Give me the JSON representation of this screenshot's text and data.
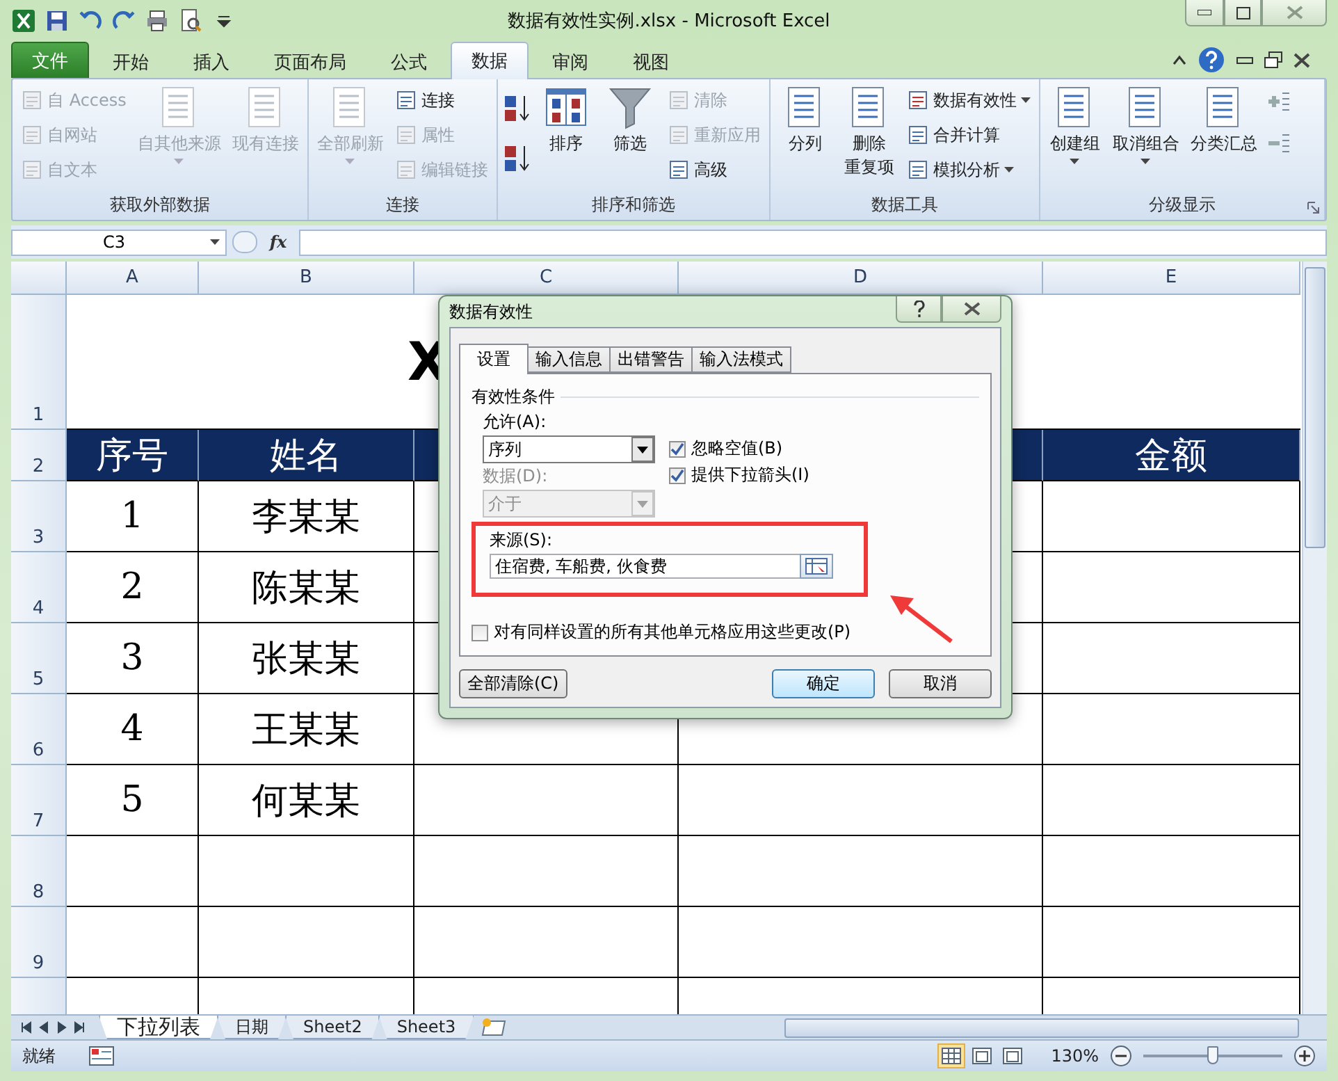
{
  "window": {
    "title": "数据有效性实例.xlsx - Microsoft Excel"
  },
  "ribbon_tabs": [
    {
      "label": "文件",
      "kind": "file",
      "selected": false
    },
    {
      "label": "开始",
      "kind": "tab",
      "selected": false
    },
    {
      "label": "插入",
      "kind": "tab",
      "selected": false
    },
    {
      "label": "页面布局",
      "kind": "tab",
      "selected": false
    },
    {
      "label": "公式",
      "kind": "tab",
      "selected": false
    },
    {
      "label": "数据",
      "kind": "tab",
      "selected": true
    },
    {
      "label": "审阅",
      "kind": "tab",
      "selected": false
    },
    {
      "label": "视图",
      "kind": "tab",
      "selected": false
    }
  ],
  "ribbon_groups": [
    {
      "label": "获取外部数据",
      "launcher": false,
      "items": [
        {
          "kind": "stack",
          "entries": [
            {
              "label": "自 Access",
              "disabled": true,
              "dropdown": false
            },
            {
              "label": "自网站",
              "disabled": true,
              "dropdown": false
            },
            {
              "label": "自文本",
              "disabled": true,
              "dropdown": false
            }
          ]
        },
        {
          "kind": "large",
          "label": "自其他来源",
          "disabled": true,
          "dropdown": true
        },
        {
          "kind": "large",
          "label": "现有连接",
          "disabled": true,
          "dropdown": false
        }
      ]
    },
    {
      "label": "连接",
      "launcher": false,
      "items": [
        {
          "kind": "large",
          "label": "全部刷新",
          "disabled": true,
          "dropdown": true
        },
        {
          "kind": "stack",
          "entries": [
            {
              "label": "连接",
              "disabled": false,
              "dropdown": false
            },
            {
              "label": "属性",
              "disabled": true,
              "dropdown": false
            },
            {
              "label": "编辑链接",
              "disabled": true,
              "dropdown": false
            }
          ]
        }
      ]
    },
    {
      "label": "排序和筛选",
      "launcher": false,
      "items": [
        {
          "kind": "sort"
        },
        {
          "kind": "large",
          "label": "排序",
          "disabled": false,
          "dropdown": false
        },
        {
          "kind": "large",
          "label": "筛选",
          "disabled": false,
          "dropdown": false
        },
        {
          "kind": "stack",
          "entries": [
            {
              "label": "清除",
              "disabled": true,
              "dropdown": false
            },
            {
              "label": "重新应用",
              "disabled": true,
              "dropdown": false
            },
            {
              "label": "高级",
              "disabled": false,
              "dropdown": false
            }
          ]
        }
      ]
    },
    {
      "label": "数据工具",
      "launcher": false,
      "items": [
        {
          "kind": "large",
          "label": "分列",
          "disabled": false,
          "dropdown": false
        },
        {
          "kind": "large",
          "lines": [
            "删除",
            "重复项"
          ],
          "disabled": false,
          "dropdown": false
        },
        {
          "kind": "stack",
          "entries": [
            {
              "label": "数据有效性",
              "disabled": false,
              "dropdown": true
            },
            {
              "label": "合并计算",
              "disabled": false,
              "dropdown": false
            },
            {
              "label": "模拟分析",
              "disabled": false,
              "dropdown": true
            }
          ]
        }
      ]
    },
    {
      "label": "分级显示",
      "launcher": true,
      "items": [
        {
          "kind": "large",
          "label": "创建组",
          "disabled": false,
          "dropdown": true
        },
        {
          "kind": "large",
          "label": "取消组合",
          "disabled": false,
          "dropdown": true
        },
        {
          "kind": "large",
          "label": "分类汇总",
          "disabled": false,
          "dropdown": false
        },
        {
          "kind": "detail"
        }
      ]
    }
  ],
  "formula_bar": {
    "name_box": "C3",
    "fx": "fx"
  },
  "sheet": {
    "columns": [
      "A",
      "B",
      "C",
      "D",
      "E"
    ],
    "row_numbers": [
      "1",
      "2",
      "3",
      "4",
      "5",
      "6",
      "7",
      "8",
      "9"
    ],
    "title": "X",
    "header": {
      "a": "序号",
      "b": "姓名",
      "e": "金额"
    },
    "rows": [
      {
        "number": "1",
        "name": "李某某"
      },
      {
        "number": "2",
        "name": "陈某某"
      },
      {
        "number": "3",
        "name": "张某某"
      },
      {
        "number": "4",
        "name": "王某某"
      },
      {
        "number": "5",
        "name": "何某某"
      }
    ]
  },
  "sheet_tabs": [
    {
      "label": "下拉列表",
      "selected": true
    },
    {
      "label": "日期",
      "selected": false
    },
    {
      "label": "Sheet2",
      "selected": false
    },
    {
      "label": "Sheet3",
      "selected": false
    }
  ],
  "status_bar": {
    "status": "就绪",
    "views": [
      {
        "selected": true
      },
      {
        "selected": false
      },
      {
        "selected": false
      }
    ],
    "zoom": {
      "label": "130%",
      "level": 0.5
    }
  },
  "dialog": {
    "title": "数据有效性",
    "tabs": [
      {
        "label": "设置",
        "selected": true
      },
      {
        "label": "输入信息",
        "selected": false
      },
      {
        "label": "出错警告",
        "selected": false
      },
      {
        "label": "输入法模式",
        "selected": false
      }
    ],
    "section": "有效性条件",
    "allow": {
      "label": "允许(A):",
      "value": "序列"
    },
    "data": {
      "label": "数据(D):",
      "value": "介于",
      "disabled": true
    },
    "options": [
      {
        "label": "忽略空值(B)",
        "checked": true
      },
      {
        "label": "提供下拉箭头(I)",
        "checked": true
      }
    ],
    "source": {
      "label": "来源(S):",
      "value": "住宿费, 车船费, 伙食费",
      "highlighted": true
    },
    "apply_all": {
      "label": "对有同样设置的所有其他单元格应用这些更改(P)",
      "checked": false
    },
    "buttons": [
      {
        "label": "全部清除(C)",
        "kind": "clear"
      },
      {
        "label": "确定",
        "kind": "ok"
      },
      {
        "label": "取消",
        "kind": "cancel"
      }
    ]
  }
}
